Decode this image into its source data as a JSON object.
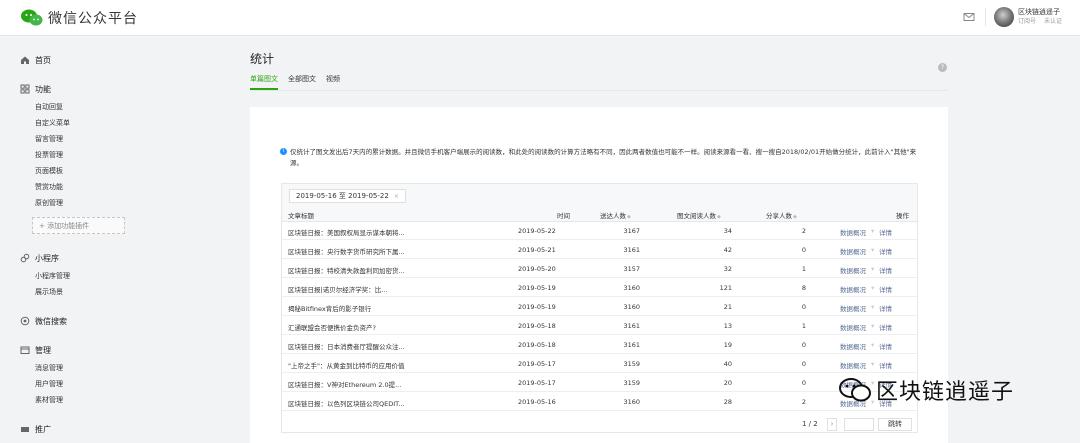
{
  "app": {
    "title": "微信公众平台"
  },
  "account": {
    "name": "区块链逍遥子",
    "type": "订阅号",
    "status": "未认证"
  },
  "sidebar": {
    "home": "首页",
    "function": {
      "label": "功能",
      "items": [
        "自动回复",
        "自定义菜单",
        "留言管理",
        "投票管理",
        "页面模板",
        "赞赏功能",
        "原创管理"
      ],
      "add_plugin": "+ 添加功能插件"
    },
    "miniprogram": {
      "label": "小程序",
      "items": [
        "小程序管理",
        "展示场景"
      ]
    },
    "search": {
      "label": "微信搜索"
    },
    "manage": {
      "label": "管理",
      "items": [
        "消息管理",
        "用户管理",
        "素材管理"
      ]
    },
    "promote": {
      "label": "推广"
    }
  },
  "page": {
    "title": "统计",
    "tabs": [
      "单篇图文",
      "全部图文",
      "视频"
    ],
    "notice": "仅统计了图文发出后7天内的累计数据。并且微信手机客户端展示的阅读数，和此处的阅读数的计算方法略有不同，因此两者数值也可能不一样。阅读来源看一看、搜一搜自2018/02/01开始做分统计，此前计入\"其他\"来源。"
  },
  "table": {
    "date_range": "2019-05-16 至 2019-05-22",
    "columns": {
      "title": "文章标题",
      "time": "时间",
      "sent": "送达人数",
      "reads": "图文阅读人数",
      "shares": "分享人数",
      "action": "操作"
    },
    "action_overview": "数据概况",
    "action_detail": "详情",
    "rows": [
      {
        "title": "区块链日报：美国叙权局显示谋本朝将...",
        "time": "2019-05-22",
        "sent": "3167",
        "reads": "34",
        "shares": "2"
      },
      {
        "title": "区块链日报：央行数字货币研究所下属...",
        "time": "2019-05-21",
        "sent": "3161",
        "reads": "42",
        "shares": "0"
      },
      {
        "title": "区块链日报：特校清失款盈利同加密货...",
        "time": "2019-05-20",
        "sent": "3157",
        "reads": "32",
        "shares": "1"
      },
      {
        "title": "区块链日报|诺贝尔经济学奖：比...",
        "time": "2019-05-19",
        "sent": "3160",
        "reads": "121",
        "shares": "8"
      },
      {
        "title": "揭秘Bitfinex背后的影子银行",
        "time": "2019-05-19",
        "sent": "3160",
        "reads": "21",
        "shares": "0"
      },
      {
        "title": "汇通联盟会否便携价金负资产?",
        "time": "2019-05-18",
        "sent": "3161",
        "reads": "13",
        "shares": "1"
      },
      {
        "title": "区块链日报：日本消费者厅提醒公众注...",
        "time": "2019-05-18",
        "sent": "3161",
        "reads": "19",
        "shares": "0"
      },
      {
        "title": "\"上帝之手\"：从黄金到比特币的应用价值",
        "time": "2019-05-17",
        "sent": "3159",
        "reads": "40",
        "shares": "0"
      },
      {
        "title": "区块链日报：V神对Ethereum 2.0提...",
        "time": "2019-05-17",
        "sent": "3159",
        "reads": "20",
        "shares": "0"
      },
      {
        "title": "区块链日报：以色列区块链公司QEDIT...",
        "time": "2019-05-16",
        "sent": "3160",
        "reads": "28",
        "shares": "2"
      }
    ],
    "pager": {
      "info": "1 / 2",
      "next": "›",
      "jump": "跳转"
    }
  },
  "watermark": {
    "text": "区块链逍遥子"
  }
}
